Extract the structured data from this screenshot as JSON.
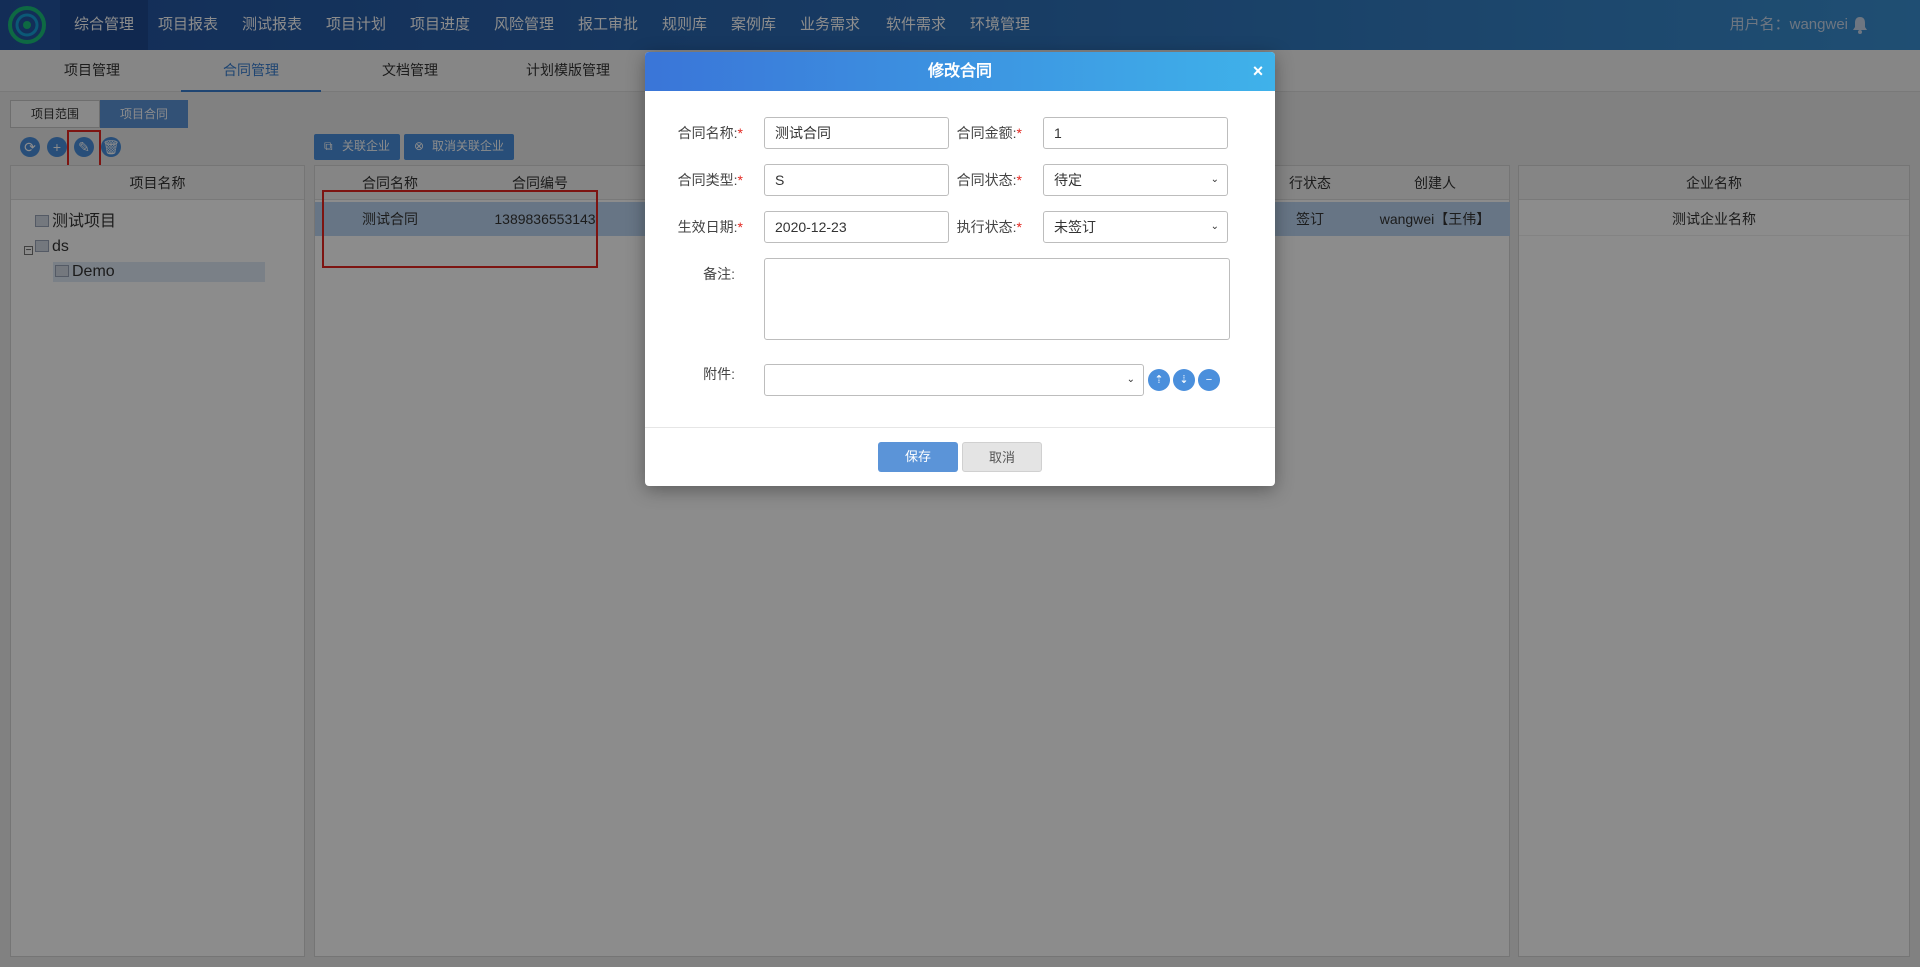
{
  "nav": {
    "items": [
      "综合管理",
      "项目报表",
      "测试报表",
      "项目计划",
      "项目进度",
      "风险管理",
      "报工审批",
      "规则库",
      "案例库",
      "业务需求",
      "软件需求",
      "环境管理"
    ],
    "active_index": 0,
    "user_label": "用户名：wangwei"
  },
  "subtabs": {
    "items": [
      "项目管理",
      "合同管理",
      "文档管理",
      "计划模版管理"
    ],
    "active_index": 1
  },
  "inner_tabs": [
    "项目范围",
    "项目合同"
  ],
  "left_panel": {
    "header": "项目名称",
    "tree": [
      {
        "label": "测试项目"
      },
      {
        "label": "ds",
        "expanded": true
      },
      {
        "label": "Demo"
      }
    ]
  },
  "toolbar": {
    "icons": [
      "refresh-icon",
      "add-icon",
      "edit-icon",
      "delete-icon"
    ]
  },
  "middle_panel": {
    "link_button": "关联企业",
    "unlink_button": "取消关联企业",
    "columns": [
      "合同名称",
      "合同编号",
      "行状态",
      "创建人"
    ],
    "rows": [
      {
        "name": "测试合同",
        "number": "1389836553143",
        "status": "签订",
        "creator": "wangwei【王伟】"
      }
    ]
  },
  "right_panel": {
    "header": "企业名称",
    "rows": [
      "测试企业名称"
    ]
  },
  "modal": {
    "title": "修改合同",
    "close": "×",
    "fields": {
      "name_label": "合同名称:",
      "name_value": "测试合同",
      "amount_label": "合同金额:",
      "amount_value": "1",
      "type_label": "合同类型:",
      "type_value": "S",
      "status_label": "合同状态:",
      "status_value": "待定",
      "date_label": "生效日期:",
      "date_value": "2020-12-23",
      "exec_label": "执行状态:",
      "exec_value": "未签订",
      "remark_label": "备注:",
      "remark_value": "",
      "attach_label": "附件:",
      "attach_value": ""
    },
    "save_label": "保存",
    "cancel_label": "取消"
  },
  "colors": {
    "accent": "#4a8fdc",
    "highlight": "#e3261f",
    "header_gradient_start": "#3a75d8",
    "header_gradient_end": "#3fb2ea"
  }
}
